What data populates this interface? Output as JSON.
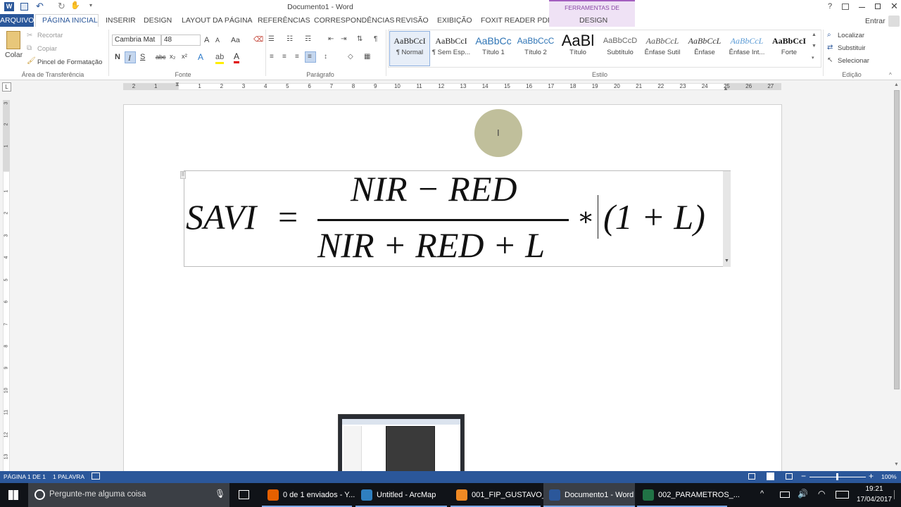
{
  "window": {
    "title": "Documento1 - Word",
    "contextual_tab_group": "FERRAMENTAS DE EQUAÇÃO",
    "help": "?",
    "signin": "Entrar"
  },
  "qat": {
    "save": "save-icon",
    "undo": "undo-icon",
    "redo": "redo-icon",
    "touch": "touch-mode-icon"
  },
  "tabs": {
    "arquivo": "ARQUIVO",
    "inicial": "PÁGINA INICIAL",
    "inserir": "INSERIR",
    "design": "DESIGN",
    "layout": "LAYOUT DA PÁGINA",
    "referencias": "REFERÊNCIAS",
    "correspondencias": "CORRESPONDÊNCIAS",
    "revisao": "REVISÃO",
    "exibicao": "EXIBIÇÃO",
    "foxit": "FOXIT READER PDF",
    "eq_design": "DESIGN"
  },
  "clipboard": {
    "colar": "Colar",
    "recortar": "Recortar",
    "copiar": "Copiar",
    "pincel": "Pincel de Formatação",
    "label": "Área de Transferência"
  },
  "font": {
    "name": "Cambria Mat",
    "size": "48",
    "label": "Fonte",
    "bold": "N",
    "italic": "I",
    "underline": "S",
    "strike": "abc",
    "sub": "x₂",
    "sup": "x²",
    "case": "Aa",
    "grow": "A",
    "shrink": "A"
  },
  "paragraph": {
    "label": "Parágrafo"
  },
  "styles": {
    "label": "Estilo",
    "items": [
      {
        "preview": "AaBbCcI",
        "name": "¶ Normal"
      },
      {
        "preview": "AaBbCcI",
        "name": "¶ Sem Esp..."
      },
      {
        "preview": "AaBbCc",
        "name": "Título 1"
      },
      {
        "preview": "AaBbCcC",
        "name": "Título 2"
      },
      {
        "preview": "AaBl",
        "name": "Título"
      },
      {
        "preview": "AaBbCcD",
        "name": "Subtítulo"
      },
      {
        "preview": "AaBbCcL",
        "name": "Ênfase Sutil"
      },
      {
        "preview": "AaBbCcL",
        "name": "Ênfase"
      },
      {
        "preview": "AaBbCcL",
        "name": "Ênfase Int..."
      },
      {
        "preview": "AaBbCcI",
        "name": "Forte"
      }
    ]
  },
  "editing": {
    "label": "Edição",
    "find": "Localizar",
    "replace": "Substituir",
    "select": "Selecionar"
  },
  "ruler": {
    "h_ticks": [
      "2",
      "1",
      "1",
      "2",
      "3",
      "4",
      "5",
      "6",
      "7",
      "8",
      "9",
      "10",
      "11",
      "12",
      "13",
      "14",
      "15",
      "16",
      "17",
      "18",
      "19",
      "20",
      "21",
      "22",
      "23",
      "24",
      "25",
      "26",
      "27"
    ],
    "v_ticks": [
      "3",
      "2",
      "1",
      "1",
      "2",
      "3",
      "4",
      "5",
      "6",
      "7",
      "8",
      "9",
      "10",
      "11",
      "12",
      "13"
    ],
    "corner": "L"
  },
  "equation": {
    "lhs": "SAVI",
    "eq": "=",
    "numerator": "NIR − RED",
    "denominator": "NIR + RED + L",
    "op": "∗",
    "factor": "(1 + L)"
  },
  "status": {
    "page": "PÁGINA 1 DE 1",
    "words": "1 PALAVRA",
    "zoom": "100%"
  },
  "taskbar": {
    "search": "Pergunte-me alguma coisa",
    "apps": [
      {
        "label": "0 de 1 enviados - Y...",
        "icon": "firefox-icon",
        "color": "#e66000"
      },
      {
        "label": "Untitled - ArcMap",
        "icon": "arcmap-icon",
        "color": "#2f7fbf"
      },
      {
        "label": "001_FIP_GUSTAVO_...",
        "icon": "foxit-icon",
        "color": "#f08a24"
      },
      {
        "label": "Documento1 - Word",
        "icon": "word-icon",
        "color": "#2b579a"
      },
      {
        "label": "002_PARAMETROS_...",
        "icon": "excel-icon",
        "color": "#217346"
      }
    ],
    "time": "19:21",
    "date": "17/04/2017"
  }
}
